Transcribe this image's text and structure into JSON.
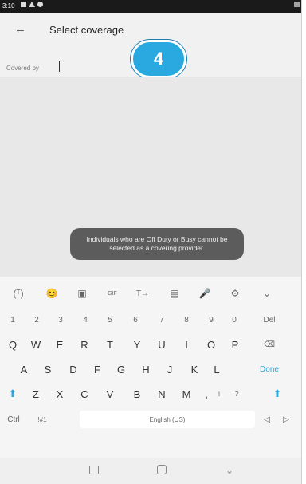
{
  "status": {
    "time": "3:10"
  },
  "appbar": {
    "back_label": "←",
    "title": "Select coverage"
  },
  "field": {
    "label": "Covered by",
    "value": ""
  },
  "badge": {
    "number": "4"
  },
  "toast": {
    "message": "Individuals who are Off Duty or Busy cannot be selected as a covering provider."
  },
  "keyboard": {
    "toolbar": [
      "(ᵀ)",
      "😊",
      "▣",
      "GIF",
      "T→",
      "▤",
      "🎤",
      "⚙",
      "⌄"
    ],
    "row1": [
      "1",
      "2",
      "3",
      "4",
      "5",
      "6",
      "7",
      "8",
      "9",
      "0",
      "Del"
    ],
    "row2": [
      "Q",
      "W",
      "E",
      "R",
      "T",
      "Y",
      "U",
      "I",
      "O",
      "P",
      "⌫"
    ],
    "row3": [
      "A",
      "S",
      "D",
      "F",
      "G",
      "H",
      "J",
      "K",
      "L",
      "Done"
    ],
    "row4": [
      "⬆",
      "Z",
      "X",
      "C",
      "V",
      "B",
      "N",
      "M",
      ",",
      "!",
      "?",
      "⬆"
    ],
    "row5": {
      "ctrl": "Ctrl",
      "sym": "!#1",
      "space": "English (US)",
      "left": "◁",
      "right": "▷"
    }
  },
  "navbar": {
    "back": "⌄"
  }
}
